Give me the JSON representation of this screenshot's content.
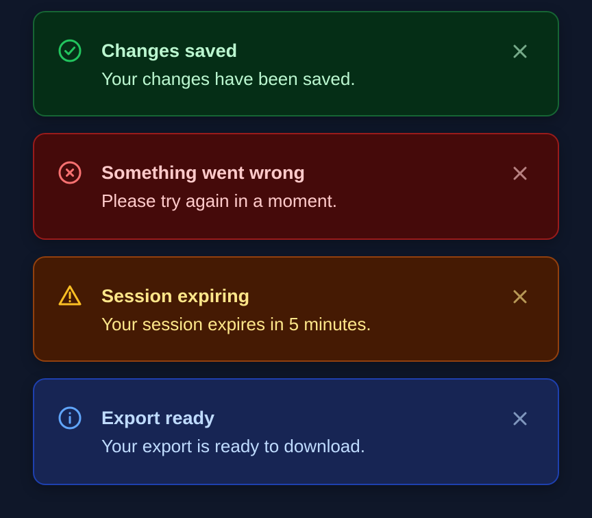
{
  "toasts": [
    {
      "type": "success",
      "icon": "check-circle-icon",
      "title": "Changes saved",
      "message": "Your changes have been saved.",
      "accent": "#22c55e",
      "close_label": "Dismiss"
    },
    {
      "type": "error",
      "icon": "x-circle-icon",
      "title": "Something went wrong",
      "message": "Please try again in a moment.",
      "accent": "#f87171",
      "close_label": "Dismiss"
    },
    {
      "type": "warning",
      "icon": "warning-triangle-icon",
      "title": "Session expiring",
      "message": "Your session expires in 5 minutes.",
      "accent": "#fbbf24",
      "close_label": "Dismiss"
    },
    {
      "type": "info",
      "icon": "info-circle-icon",
      "title": "Export ready",
      "message": "Your export is ready to download.",
      "accent": "#60a5fa",
      "close_label": "Dismiss"
    }
  ]
}
